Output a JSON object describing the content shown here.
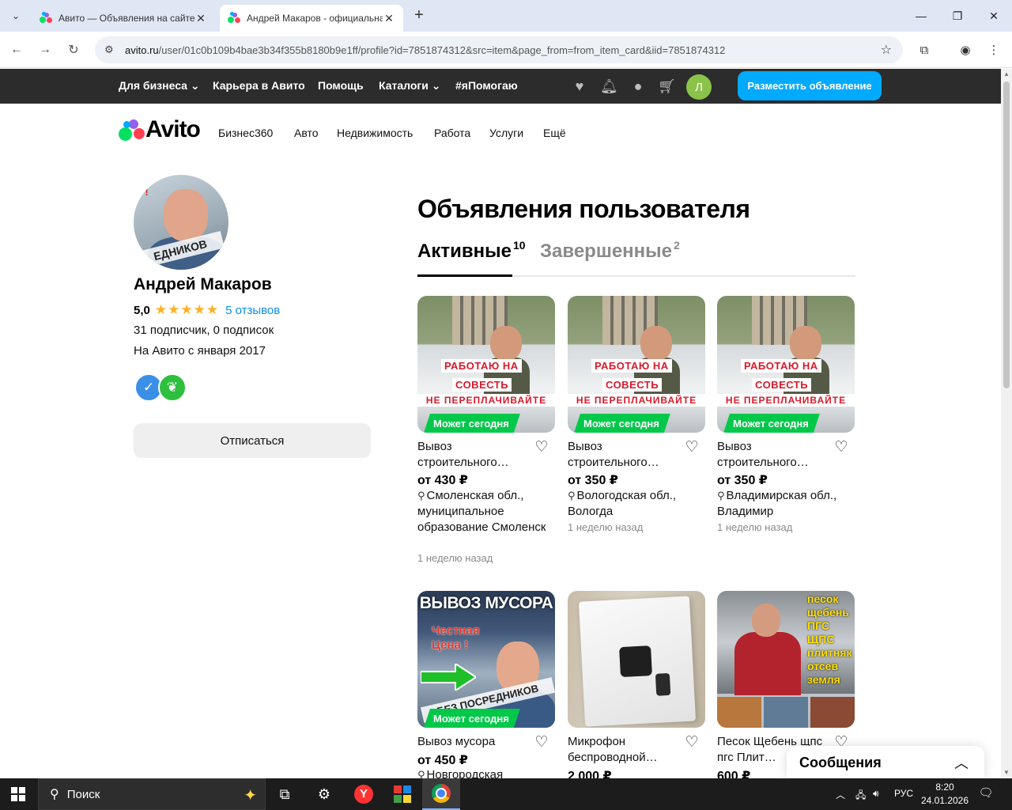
{
  "browser": {
    "tabs": [
      {
        "title": "Авито — Объявления на сайте Авито",
        "active": false
      },
      {
        "title": "Андрей Макаров - официальная страница",
        "active": true
      }
    ],
    "url_host": "avito.ru",
    "url_path": "/user/01c0b109b4bae3b34f355b8180b9e1ff/profile?id=7851874312&src=item&page_from=from_item_card&iid=7851874312"
  },
  "topbar": {
    "links": [
      "Для бизнеса",
      "Карьера в Авито",
      "Помощь",
      "Каталоги",
      "#яПомогаю"
    ],
    "user_initial": "Л",
    "post_ad_label": "Разместить объявление"
  },
  "nav": {
    "logo_text": "Avito",
    "categories": [
      "Бизнес360",
      "Авто",
      "Недвижимость",
      "Работа",
      "Услуги",
      "Ещё"
    ]
  },
  "profile": {
    "photo_corner": "ая !",
    "photo_band": "ЕДНИКОВ",
    "name": "Андрей Макаров",
    "rating": "5,0",
    "stars": "★★★★★",
    "reviews": "5 отзывов",
    "subscribers": "31 подписчик, 0 подписок",
    "since": "На Авито с января 2017",
    "unsubscribe_label": "Отписаться"
  },
  "listings": {
    "title": "Объявления пользователя",
    "tab_active": "Активные",
    "tab_active_count": "10",
    "tab_done": "Завершенные",
    "tab_done_count": "2",
    "work_banner": {
      "line1": "РАБОТАЮ НА",
      "line2": "СОВЕСТЬ",
      "line3": "НЕ ПЕРЕПЛАЧИВАЙТЕ"
    },
    "trash_banner": {
      "headline": "ВЫВОЗ МУСОРА",
      "sub1": "Честная",
      "sub2": "Цена !",
      "band": "БЕЗ ПОСРЕДНИКОВ"
    },
    "sand_words": [
      "песок",
      "щебень",
      "ПГС",
      "ЩПС",
      "плитняк",
      "отсев",
      "земля"
    ],
    "badge_today": "Может сегодня",
    "items": [
      {
        "title": "Вывоз строительного…",
        "price": "от 430 ₽",
        "location": "Смоленская обл., муниципальное образование Смоленск",
        "date": "1 неделю назад"
      },
      {
        "title": "Вывоз строительного…",
        "price": "от 350 ₽",
        "location": "Вологодская обл., Вологда",
        "date": "1 неделю назад"
      },
      {
        "title": "Вывоз строительного…",
        "price": "от 350 ₽",
        "location": "Владимирская обл., Владимир",
        "date": "1 неделю назад"
      },
      {
        "title": "Вывоз мусора",
        "price": "от 450 ₽",
        "location": "Новгородская"
      },
      {
        "title": "Микрофон беспроводной…",
        "price": "2 000 ₽"
      },
      {
        "title": "Песок Щебень щпс пгс Плит…",
        "price": "600 ₽"
      }
    ]
  },
  "messages": {
    "label": "Сообщения"
  },
  "taskbar": {
    "search_placeholder": "Поиск",
    "lang": "РУС",
    "time": "8:20",
    "date": "24.01.2026"
  }
}
